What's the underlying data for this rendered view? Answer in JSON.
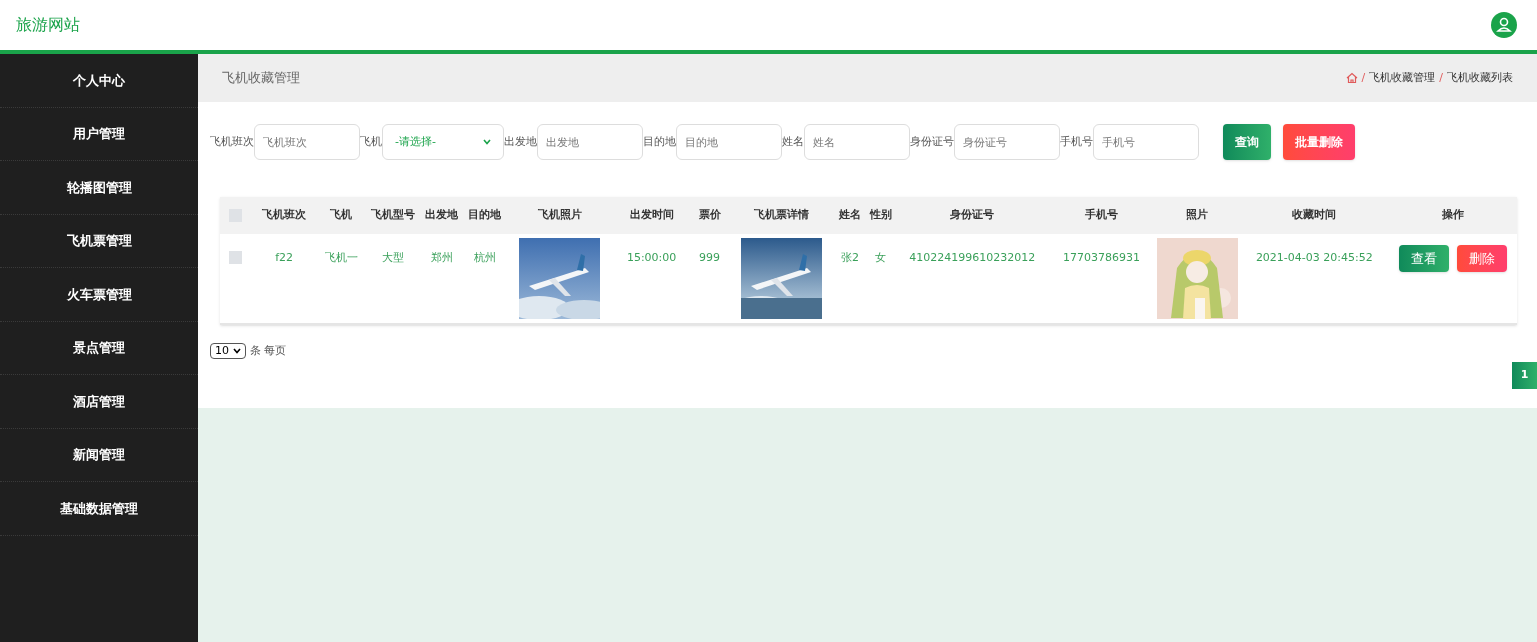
{
  "brand": "旅游网站",
  "sidebar": {
    "items": [
      {
        "label": "个人中心"
      },
      {
        "label": "用户管理"
      },
      {
        "label": "轮播图管理"
      },
      {
        "label": "飞机票管理"
      },
      {
        "label": "火车票管理"
      },
      {
        "label": "景点管理"
      },
      {
        "label": "酒店管理"
      },
      {
        "label": "新闻管理"
      },
      {
        "label": "基础数据管理"
      }
    ]
  },
  "page_title": "飞机收藏管理",
  "breadcrumb": {
    "separator": "/",
    "items": [
      "飞机收藏管理",
      "飞机收藏列表"
    ]
  },
  "filters": [
    {
      "kind": "input",
      "label": "飞机班次",
      "placeholder": "飞机班次"
    },
    {
      "kind": "select",
      "label": "飞机",
      "value": "-请选择-"
    },
    {
      "kind": "input",
      "label": "出发地",
      "placeholder": "出发地"
    },
    {
      "kind": "input",
      "label": "目的地",
      "placeholder": "目的地"
    },
    {
      "kind": "input",
      "label": "姓名",
      "placeholder": "姓名"
    },
    {
      "kind": "input",
      "label": "身份证号",
      "placeholder": "身份证号"
    },
    {
      "kind": "input",
      "label": "手机号",
      "placeholder": "手机号"
    }
  ],
  "filter_buttons": [
    {
      "kind": "primary",
      "label": "查询"
    },
    {
      "kind": "danger",
      "label": "批量删除"
    }
  ],
  "table": {
    "header_checked": false,
    "columns": [
      "飞机班次",
      "飞机",
      "飞机型号",
      "出发地",
      "目的地",
      "飞机照片",
      "出发时间",
      "票价",
      "飞机票详情",
      "姓名",
      "性别",
      "身份证号",
      "手机号",
      "照片",
      "收藏时间",
      "操作"
    ],
    "rows": [
      {
        "checked": false,
        "cells": [
          {
            "kind": "text",
            "text": "f22"
          },
          {
            "kind": "text",
            "text": "飞机一"
          },
          {
            "kind": "text",
            "text": "大型"
          },
          {
            "kind": "text",
            "text": "郑州"
          },
          {
            "kind": "text",
            "text": "杭州"
          },
          {
            "kind": "picture"
          },
          {
            "kind": "text",
            "text": "15:00:00"
          },
          {
            "kind": "text",
            "text": "999"
          },
          {
            "kind": "picture"
          },
          {
            "kind": "text",
            "text": "张2"
          },
          {
            "kind": "text",
            "text": "女"
          },
          {
            "kind": "text",
            "text": "410224199610232012"
          },
          {
            "kind": "text",
            "text": "17703786931"
          },
          {
            "kind": "picture"
          },
          {
            "kind": "text",
            "text": "2021-04-03 20:45:52"
          },
          {
            "kind": "actions",
            "buttons": [
              {
                "kind": "primary",
                "label": "查看"
              },
              {
                "kind": "danger",
                "label": "删除"
              }
            ]
          }
        ]
      }
    ]
  },
  "page_size": {
    "value": "10",
    "label": "条 每页"
  },
  "pagination": [
    {
      "label": "1",
      "selected": true
    }
  ]
}
